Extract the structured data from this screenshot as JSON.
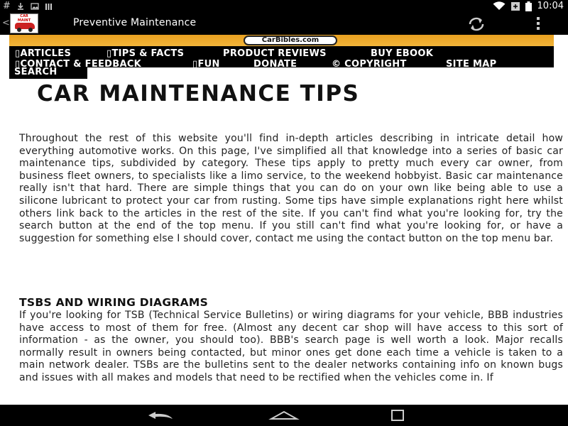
{
  "status_bar": {
    "left_icons": [
      "hash-icon",
      "download-icon",
      "image-icon",
      "bars-icon"
    ],
    "time": "10:04"
  },
  "action_bar": {
    "back_glyph": "<",
    "title": "Preventive Maintenance"
  },
  "banner": {
    "site_name": "CarBibles.com"
  },
  "top_menu": [
    "▯ARTICLES",
    "▯TIPS & FACTS",
    "PRODUCT REVIEWS",
    "BUY EBOOK",
    "▯CONTACT & FEEDBACK",
    "▯FUN",
    "DONATE",
    "© COPYRIGHT",
    "SITE MAP",
    "SEARCH"
  ],
  "article": {
    "heading": "CAR MAINTENANCE TIPS",
    "intro": "Throughout the rest of this website you'll find in-depth articles describing in intricate detail how everything automotive works. On this page, I've simplified all that knowledge into a series of basic car maintenance tips, subdivided by category. These tips apply to pretty much every car owner, from business fleet owners, to specialists like a limo service, to the weekend hobbyist. Basic car maintenance really isn't that hard. There are simple things that you can do on your own like being able to use a silicone lubricant to protect your car from rusting. Some tips have simple explanations right here whilst others link back to the articles in the rest of the site. If you can't find what you're looking for, try the search button at the end of the top menu. If you still can't find what you're looking for, or have a suggestion for something else I should cover, contact me using the contact button on the top menu bar.",
    "section_heading": "TSBS AND WIRING DIAGRAMS",
    "section_text": "If you're looking for TSB (Technical Service Bulletins) or wiring diagrams for your vehicle, BBB industries have access to most of them for free. (Almost any decent car shop will have access to this sort of information - as the owner, you should too). BBB's search page is well worth a look. Major recalls normally result in owners being contacted, but minor ones get done each time a vehicle is taken to a main network dealer. TSBs are the bulletins sent to the dealer networks containing info on known bugs and issues with all makes and models that need to be rectified when the vehicles come in. If"
  },
  "colors": {
    "banner_orange": "#f0a830",
    "nav_black": "#000000"
  }
}
